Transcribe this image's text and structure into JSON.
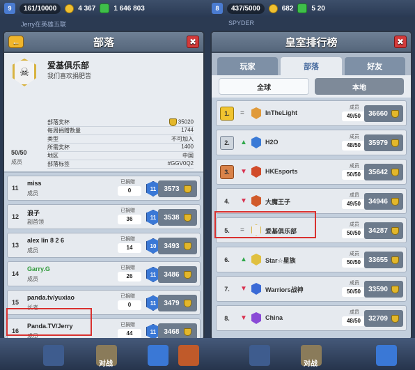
{
  "topbar_left": {
    "level": "9",
    "xp": "161/10000",
    "gold": "4 367",
    "gems": "1 646 803"
  },
  "topbar_right": {
    "level": "8",
    "xp": "437/5000",
    "gold": "682",
    "gems": "5 20"
  },
  "subbar_left": "Jerry在英雄五联",
  "subbar_right": "SPYDER",
  "bottom_nav": {
    "battle_left": "对战",
    "battle_right": "对战"
  },
  "clan_panel": {
    "title": "部落",
    "clan_name": "爱基俱乐部",
    "description": "我们喜欢捐肥皆",
    "member_count": "50/50",
    "member_label": "成员",
    "stats": [
      {
        "label": "部落奖杯",
        "value": "35020"
      },
      {
        "label": "每周捐赠数量",
        "value": "1744"
      },
      {
        "label": "类型",
        "value": "不可加入"
      },
      {
        "label": "所需奖杯",
        "value": "1400"
      },
      {
        "label": "地区",
        "value": "中国"
      },
      {
        "label": "部落标签",
        "value": "#GGV0Q2"
      }
    ],
    "donated_label": "已捐赠",
    "members": [
      {
        "rank": "11",
        "name": "miss",
        "role": "成员",
        "donated": "0",
        "level": "11",
        "trophies": "3573"
      },
      {
        "rank": "12",
        "name": "浪子",
        "role": "副首领",
        "donated": "36",
        "level": "11",
        "trophies": "3538"
      },
      {
        "rank": "13",
        "name": "alex lin 8 2 6",
        "role": "成员",
        "donated": "14",
        "level": "10",
        "trophies": "3493"
      },
      {
        "rank": "14",
        "name": "Garry.G",
        "role": "成员",
        "donated": "26",
        "level": "11",
        "trophies": "3486"
      },
      {
        "rank": "15",
        "name": "panda.tv/yuxiao",
        "role": "长老",
        "donated": "0",
        "level": "11",
        "trophies": "3479"
      },
      {
        "rank": "16",
        "name": "Panda.TV/Jerry",
        "role": "成员",
        "donated": "44",
        "level": "11",
        "trophies": "3468"
      }
    ]
  },
  "ranking_panel": {
    "title": "皇室排行榜",
    "tabs": [
      "玩家",
      "部落",
      "好友"
    ],
    "subtabs": [
      "全球",
      "本地"
    ],
    "members_label": "成员",
    "clans": [
      {
        "rank": "1.",
        "trend": "=",
        "name": "InTheLight",
        "members": "49/50",
        "trophies": "36660"
      },
      {
        "rank": "2.",
        "trend": "▲",
        "name": "H2O",
        "members": "48/50",
        "trophies": "35979"
      },
      {
        "rank": "3.",
        "trend": "▼",
        "name": "HKEsports",
        "members": "50/50",
        "trophies": "35642"
      },
      {
        "rank": "4.",
        "trend": "▼",
        "name": "大魔王子",
        "members": "49/50",
        "trophies": "34946"
      },
      {
        "rank": "5.",
        "trend": "=",
        "name": "爱基俱乐部",
        "members": "50/50",
        "trophies": "34287"
      },
      {
        "rank": "6.",
        "trend": "▲",
        "name": "Star☆星族",
        "members": "50/50",
        "trophies": "33655"
      },
      {
        "rank": "7.",
        "trend": "▼",
        "name": "Warriors战神",
        "members": "50/50",
        "trophies": "33590"
      },
      {
        "rank": "8.",
        "trend": "▼",
        "name": "China",
        "members": "48/50",
        "trophies": "32709"
      }
    ]
  },
  "colors": {
    "highlight": "#d9312f",
    "trend_up": "#2fa84a",
    "trend_down": "#d9314f"
  }
}
